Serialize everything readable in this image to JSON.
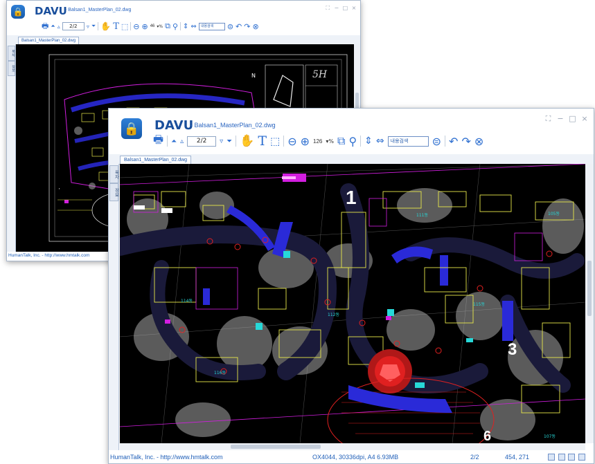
{
  "app": {
    "brand": "DAVU",
    "title_suffix": "- Balsan1_MasterPlan_02.dwg",
    "window_controls": [
      "⛶",
      "−",
      "□",
      "×"
    ]
  },
  "back_window": {
    "zoom": "46",
    "page": "2/2",
    "search_placeholder": "내용검색",
    "file_tab": "Balsan1_MasterPlan_02.dwg",
    "side_tabs": [
      "목차",
      "정보"
    ],
    "status_left": "HumanTalk, Inc. - http://www.hmtalk.com",
    "plan_labels": [
      "5H"
    ]
  },
  "front_window": {
    "zoom": "126",
    "page": "2/2",
    "search_placeholder": "내용검색",
    "file_tab": "Balsan1_MasterPlan_02.dwg",
    "side_tabs": [
      "목차",
      "정보"
    ],
    "status": {
      "company": "HumanTalk, Inc. - http://www.hmtalk.com",
      "doc_info": "OX4044, 30336dpi, A4  6.93MB",
      "page": "2/2",
      "coords": "454, 271"
    },
    "plan_labels": [
      "1",
      "3",
      "6"
    ],
    "building_tags": [
      "111동",
      "105동",
      "114동",
      "112동",
      "115동",
      "116동",
      "107동"
    ]
  },
  "toolbar_icons": [
    "printer-icon",
    "first-page-icon",
    "prev-page-icon",
    "next-page-icon",
    "last-page-icon",
    "hand-tool-icon",
    "text-select-icon",
    "area-select-icon",
    "zoom-out-icon",
    "zoom-in-icon",
    "percent-label",
    "zoom-area-icon",
    "search-icon",
    "fit-height-icon",
    "fit-width-icon",
    "search-go-icon",
    "rotate-left-icon",
    "rotate-right-icon",
    "close-doc-icon"
  ],
  "colors": {
    "accent": "#2e6fd0",
    "canvas": "#000000",
    "cad_yellow": "#e8e84a",
    "cad_magenta": "#d21ee0",
    "cad_blue": "#2a2ad8",
    "cad_cyan": "#27d8d8",
    "cad_red": "#e02020"
  }
}
